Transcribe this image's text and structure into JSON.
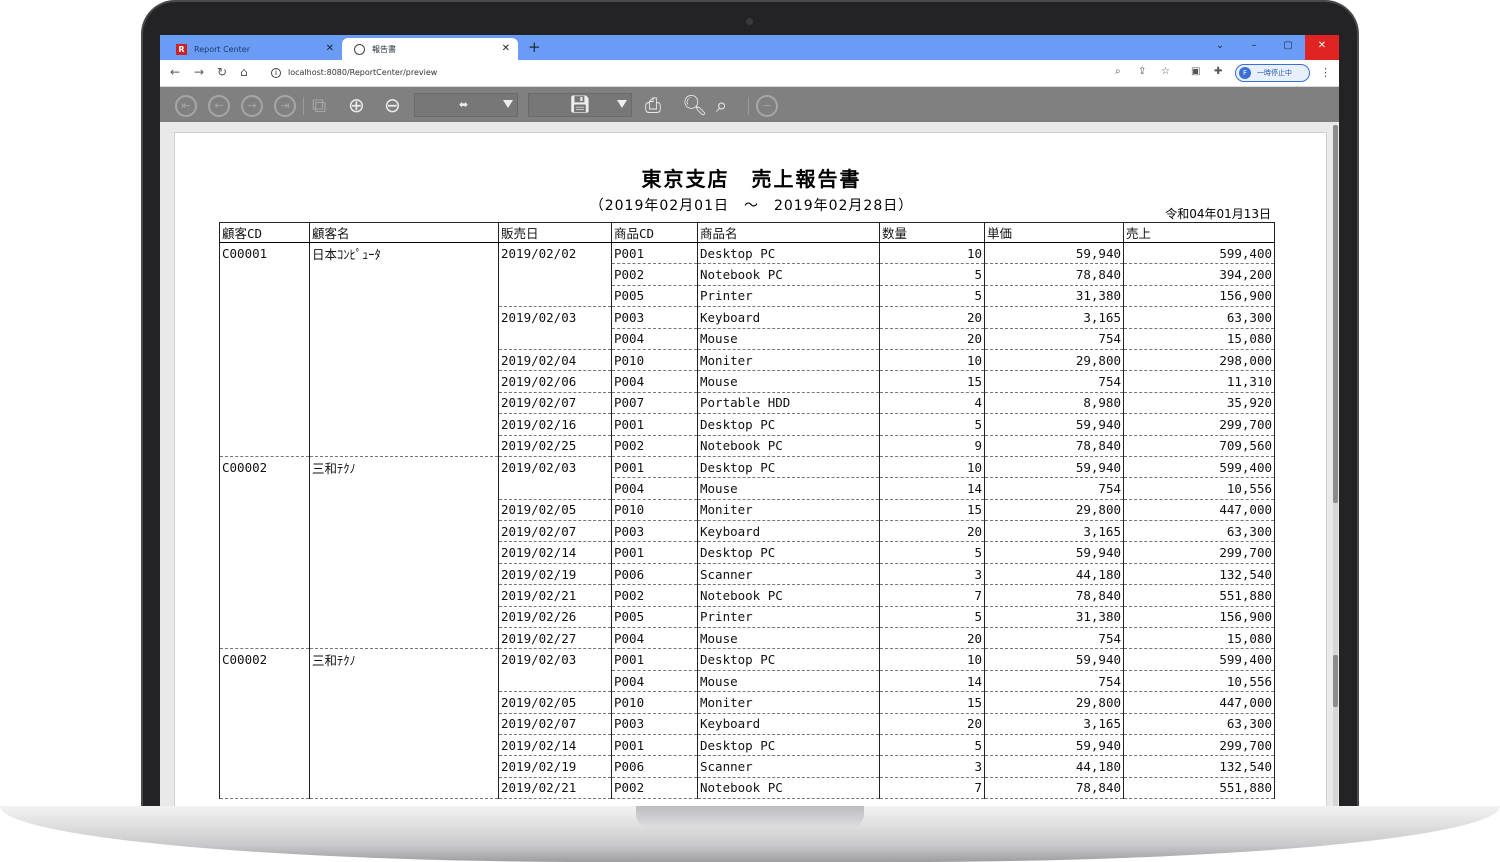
{
  "browser": {
    "tabs": [
      {
        "label": "Report Center",
        "favicon": "R",
        "active": false
      },
      {
        "label": "報告書",
        "active": true
      }
    ],
    "new_tab_label": "+",
    "url": "localhost:8080/ReportCenter/preview",
    "pause_label": "一時停止中",
    "profile_initial": "F",
    "window_controls": {
      "minimize": "–",
      "maximize": "▢",
      "close": "✕"
    }
  },
  "viewer_toolbar": {
    "icons": [
      "first-page-icon",
      "prev-page-icon",
      "next-page-icon",
      "last-page-icon",
      "page-layout-icon",
      "zoom-in-icon",
      "zoom-out-icon",
      "fit-select",
      "save-select",
      "print-icon",
      "search-icon",
      "search-options-icon",
      "close-icon"
    ]
  },
  "report": {
    "title": "東京支店　売上報告書",
    "period": "（2019年02月01日　～　2019年02月28日）",
    "issue_date": "令和04年01月13日",
    "columns": [
      "顧客CD",
      "顧客名",
      "販売日",
      "商品CD",
      "商品名",
      "数量",
      "単価",
      "売上"
    ],
    "rows": [
      [
        "C00001",
        "日本ｺﾝﾋﾟｭｰﾀ",
        "2019/02/02",
        "P001",
        "Desktop PC",
        "10",
        "59,940",
        "599,400"
      ],
      [
        "",
        "",
        "",
        "P002",
        "Notebook PC",
        "5",
        "78,840",
        "394,200"
      ],
      [
        "",
        "",
        "",
        "P005",
        "Printer",
        "5",
        "31,380",
        "156,900"
      ],
      [
        "",
        "",
        "2019/02/03",
        "P003",
        "Keyboard",
        "20",
        "3,165",
        "63,300"
      ],
      [
        "",
        "",
        "",
        "P004",
        "Mouse",
        "20",
        "754",
        "15,080"
      ],
      [
        "",
        "",
        "2019/02/04",
        "P010",
        "Moniter",
        "10",
        "29,800",
        "298,000"
      ],
      [
        "",
        "",
        "2019/02/06",
        "P004",
        "Mouse",
        "15",
        "754",
        "11,310"
      ],
      [
        "",
        "",
        "2019/02/07",
        "P007",
        "Portable HDD",
        "4",
        "8,980",
        "35,920"
      ],
      [
        "",
        "",
        "2019/02/16",
        "P001",
        "Desktop PC",
        "5",
        "59,940",
        "299,700"
      ],
      [
        "",
        "",
        "2019/02/25",
        "P002",
        "Notebook PC",
        "9",
        "78,840",
        "709,560"
      ],
      [
        "C00002",
        "三和ﾃｸﾉ",
        "2019/02/03",
        "P001",
        "Desktop PC",
        "10",
        "59,940",
        "599,400"
      ],
      [
        "",
        "",
        "",
        "P004",
        "Mouse",
        "14",
        "754",
        "10,556"
      ],
      [
        "",
        "",
        "2019/02/05",
        "P010",
        "Moniter",
        "15",
        "29,800",
        "447,000"
      ],
      [
        "",
        "",
        "2019/02/07",
        "P003",
        "Keyboard",
        "20",
        "3,165",
        "63,300"
      ],
      [
        "",
        "",
        "2019/02/14",
        "P001",
        "Desktop PC",
        "5",
        "59,940",
        "299,700"
      ],
      [
        "",
        "",
        "2019/02/19",
        "P006",
        "Scanner",
        "3",
        "44,180",
        "132,540"
      ],
      [
        "",
        "",
        "2019/02/21",
        "P002",
        "Notebook PC",
        "7",
        "78,840",
        "551,880"
      ],
      [
        "",
        "",
        "2019/02/26",
        "P005",
        "Printer",
        "5",
        "31,380",
        "156,900"
      ],
      [
        "",
        "",
        "2019/02/27",
        "P004",
        "Mouse",
        "20",
        "754",
        "15,080"
      ],
      [
        "C00002",
        "三和ﾃｸﾉ",
        "2019/02/03",
        "P001",
        "Desktop PC",
        "10",
        "59,940",
        "599,400"
      ],
      [
        "",
        "",
        "",
        "P004",
        "Mouse",
        "14",
        "754",
        "10,556"
      ],
      [
        "",
        "",
        "2019/02/05",
        "P010",
        "Moniter",
        "15",
        "29,800",
        "447,000"
      ],
      [
        "",
        "",
        "2019/02/07",
        "P003",
        "Keyboard",
        "20",
        "3,165",
        "63,300"
      ],
      [
        "",
        "",
        "2019/02/14",
        "P001",
        "Desktop PC",
        "5",
        "59,940",
        "299,700"
      ],
      [
        "",
        "",
        "2019/02/19",
        "P006",
        "Scanner",
        "3",
        "44,180",
        "132,540"
      ],
      [
        "",
        "",
        "2019/02/21",
        "P002",
        "Notebook PC",
        "7",
        "78,840",
        "551,880"
      ]
    ]
  }
}
